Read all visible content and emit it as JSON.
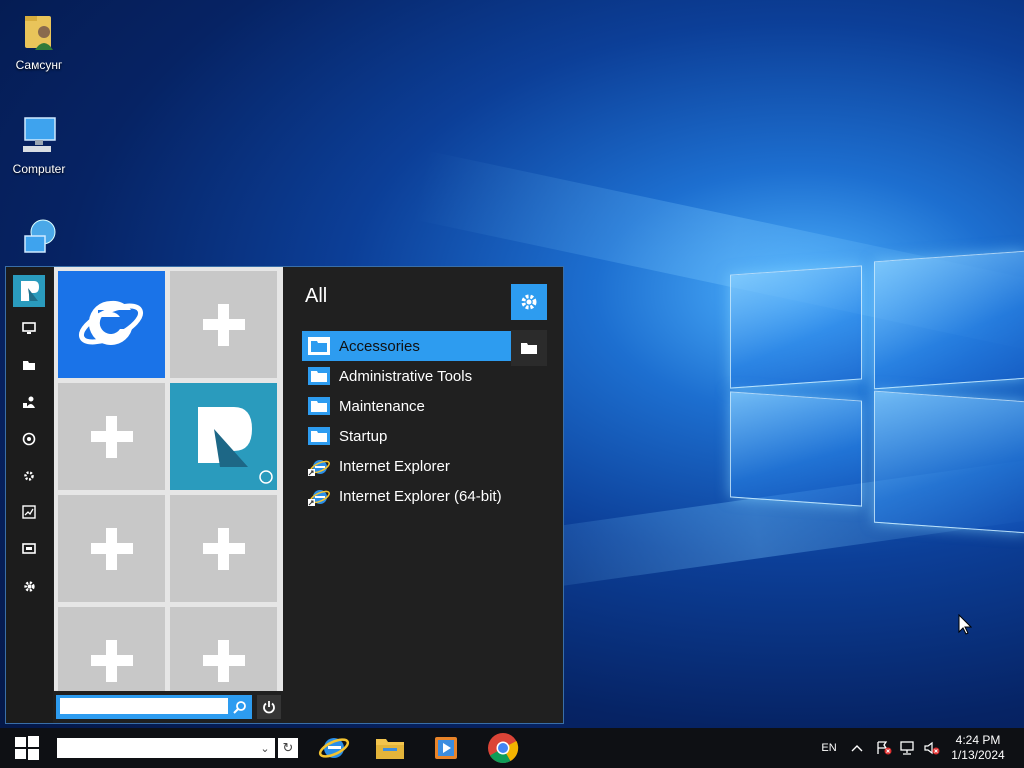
{
  "desktop": {
    "icons": [
      {
        "label": "Самсунг",
        "icon": "user-folder-icon"
      },
      {
        "label": "Computer",
        "icon": "computer-icon"
      },
      {
        "label": "",
        "icon": "network-icon"
      }
    ]
  },
  "start_menu": {
    "rail_items": [
      "app-logo-icon",
      "monitor-icon",
      "folder-icon",
      "users-icon",
      "network-icon",
      "tools-icon",
      "performance-icon",
      "display-icon",
      "settings-icon"
    ],
    "tiles": [
      {
        "name": "internet-explorer-tile",
        "color": "#1a73e8"
      },
      {
        "name": "add-tile"
      },
      {
        "name": "add-tile"
      },
      {
        "name": "app-tile",
        "color": "#2a9bbd"
      },
      {
        "name": "add-tile"
      },
      {
        "name": "add-tile"
      },
      {
        "name": "add-tile"
      },
      {
        "name": "add-tile"
      }
    ],
    "search": {
      "placeholder": "",
      "value": ""
    },
    "programs": {
      "title": "All",
      "items": [
        {
          "label": "Accessories",
          "type": "folder",
          "selected": true
        },
        {
          "label": "Administrative Tools",
          "type": "folder"
        },
        {
          "label": "Maintenance",
          "type": "folder"
        },
        {
          "label": "Startup",
          "type": "folder"
        },
        {
          "label": "Internet Explorer",
          "type": "ie-shortcut"
        },
        {
          "label": "Internet Explorer (64-bit)",
          "type": "ie-shortcut"
        }
      ]
    }
  },
  "taskbar": {
    "search_value": "",
    "apps": [
      "internet-explorer-icon",
      "file-explorer-icon",
      "media-player-icon",
      "chrome-icon"
    ],
    "tray": {
      "language": "EN",
      "time": "4:24 PM",
      "date": "1/13/2024"
    }
  },
  "colors": {
    "accent": "#2d9cf0",
    "menu_bg": "#202020",
    "tile_gray": "#c8c8c8"
  }
}
